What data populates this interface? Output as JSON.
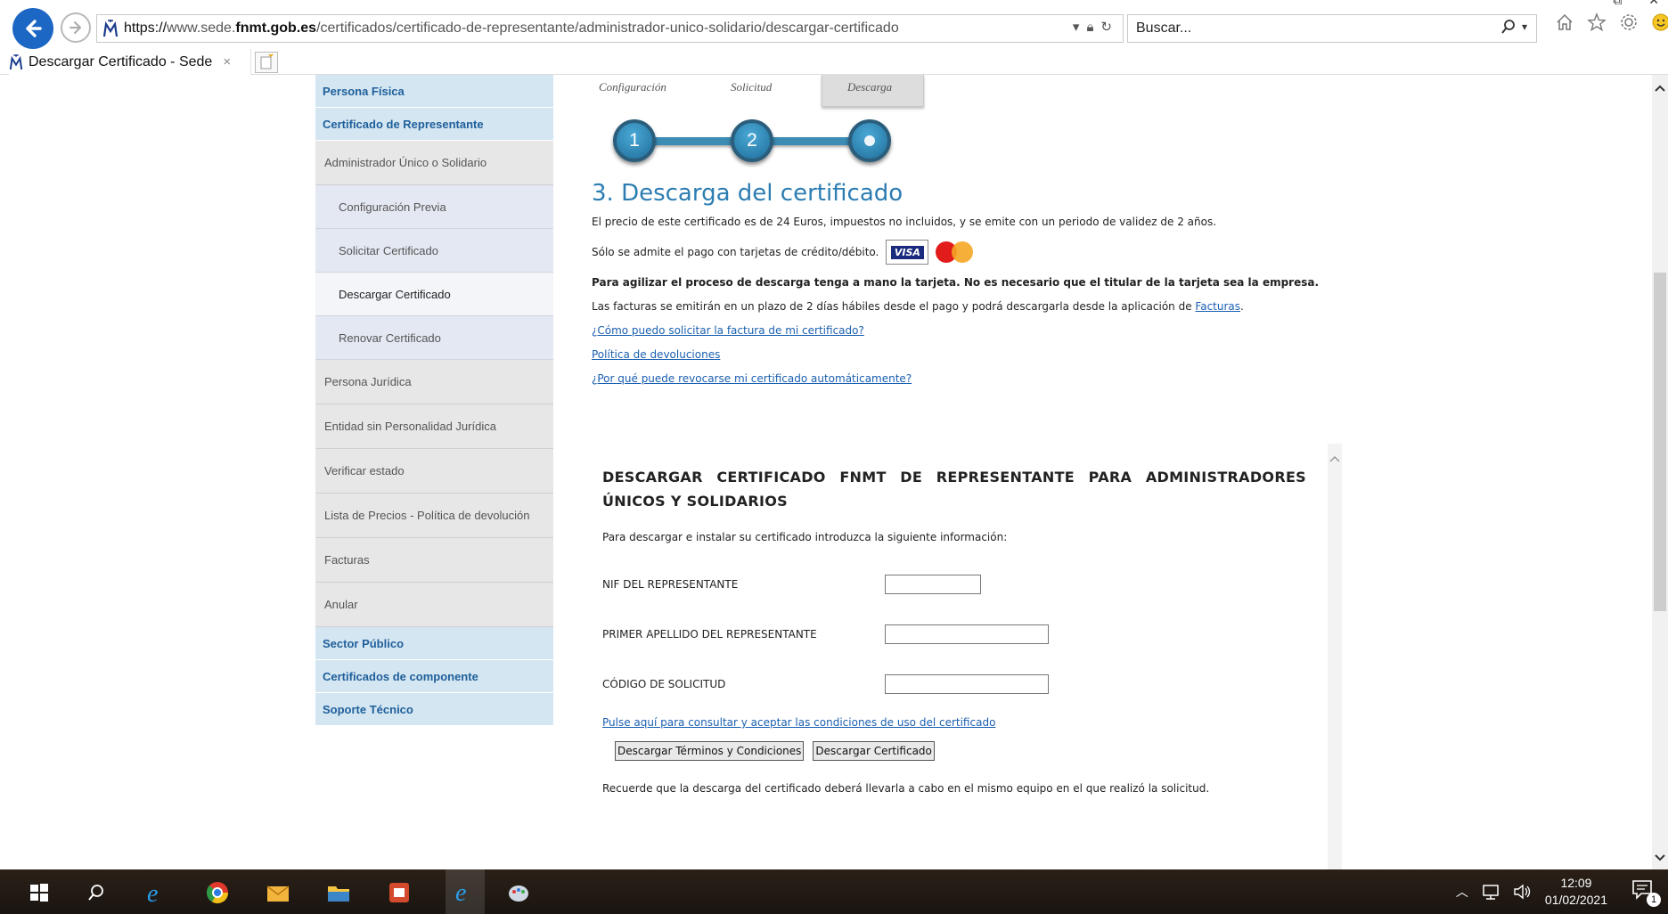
{
  "browser": {
    "url_scheme": "https://",
    "url_host_pre": "www.sede.",
    "url_host_bold": "fnmt.gob.es",
    "url_path": "/certificados/certificado-de-representante/administrador-unico-solidario/descargar-certificado",
    "search_placeholder": "Buscar...",
    "tab_title": "Descargar Certificado - Sede",
    "tab_close": "×"
  },
  "sidebar": {
    "items": [
      {
        "label": "Persona Física",
        "kind": "head"
      },
      {
        "label": "Certificado de Representante",
        "kind": "head"
      },
      {
        "label": "Administrador Único o Solidario",
        "kind": "sub"
      },
      {
        "label": "Configuración Previa",
        "kind": "sub2"
      },
      {
        "label": "Solicitar Certificado",
        "kind": "sub2"
      },
      {
        "label": "Descargar Certificado",
        "kind": "sub2-active"
      },
      {
        "label": "Renovar Certificado",
        "kind": "sub2"
      },
      {
        "label": "Persona Jurídica",
        "kind": "sub"
      },
      {
        "label": "Entidad sin Personalidad Jurídica",
        "kind": "sub"
      },
      {
        "label": "Verificar estado",
        "kind": "sub"
      },
      {
        "label": "Lista de Precios - Política de devolución",
        "kind": "sub"
      },
      {
        "label": "Facturas",
        "kind": "sub"
      },
      {
        "label": "Anular",
        "kind": "sub"
      },
      {
        "label": "Sector Público",
        "kind": "head"
      },
      {
        "label": "Certificados de componente",
        "kind": "head"
      },
      {
        "label": "Soporte Técnico",
        "kind": "head"
      }
    ]
  },
  "steps": {
    "labels": [
      "Configuración",
      "Solicitud",
      "Descarga"
    ],
    "numbers": [
      "1",
      "2"
    ],
    "active_index": 2
  },
  "main": {
    "title": "3. Descarga del certificado",
    "price_text": "El precio de este certificado es de 24 Euros, impuestos no incluidos, y se emite con un periodo de validez de 2 años.",
    "payment_text": "Sólo se admite el pago con tarjetas de crédito/débito.",
    "visa_label": "VISA",
    "card_note": "Para agilizar el proceso de descarga tenga a mano la tarjeta. No es necesario que el titular de la tarjeta sea la empresa.",
    "invoice_text": "Las facturas se emitirán en un plazo de 2 días hábiles desde el pago y podrá descargarla desde la aplicación de",
    "invoice_link": "Facturas",
    "links": [
      "¿Cómo puedo solicitar la factura de mi certificado?",
      "Política de devoluciones",
      "¿Por qué puede revocarse mi certificado automáticamente?"
    ]
  },
  "form": {
    "title": "DESCARGAR CERTIFICADO FNMT DE REPRESENTANTE PARA ADMINISTRADORES ÚNICOS Y SOLIDARIOS",
    "intro": "Para descargar e instalar su certificado introduzca la siguiente información:",
    "fields": [
      {
        "label": "NIF DEL REPRESENTANTE",
        "value": ""
      },
      {
        "label": "PRIMER APELLIDO DEL REPRESENTANTE",
        "value": ""
      },
      {
        "label": "CÓDIGO DE SOLICITUD",
        "value": ""
      }
    ],
    "conditions_link": "Pulse aquí para consultar y aceptar las condiciones de uso del certificado",
    "btn_terms": "Descargar Términos y Condiciones",
    "btn_download": "Descargar Certificado",
    "reminder": "Recuerde que la descarga del certificado deberá llevarla a cabo en el mismo equipo en el que realizó la solicitud."
  },
  "taskbar": {
    "time": "12:09",
    "date": "01/02/2021",
    "notification_count": "1"
  }
}
